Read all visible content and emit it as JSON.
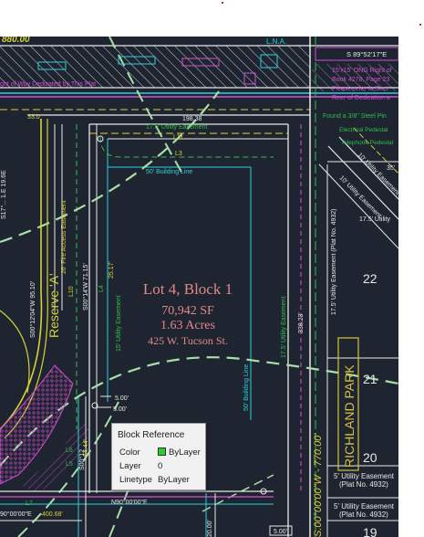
{
  "drawing": {
    "top_left_text": "880.00",
    "lna": "L.N.A.",
    "bearing_top_right": "S 89°52'17\"E",
    "row_note": [
      "15'x15' ONG Right of",
      "Book 4278, Page 23",
      "Please refer to Sect",
      "Reer of Dedication a"
    ],
    "row_dedicated": "ght of Way Dedicated by This Plat",
    "dim_33": "33.0",
    "dim_19858": "198.38",
    "util_ease_top": "17.5' Utility Easement",
    "found_pin": "Found a 3/8\" Steel Pin",
    "elec_pedestal": "Electrical Pedestal",
    "telephone_pedestal": "Telephone Pedestal",
    "l11": "L11",
    "l3": "L3",
    "building_line_top": "50' Building Line",
    "fire_access": "26' Fire Access Easement",
    "bearing_left": "S17°...  1.E 19.6E",
    "dim_35": "35'",
    "richland_util_1": "10' Utility Easement (Plat",
    "richland_util_2": "10' Utility Easement",
    "util_175_small": "17.5' Utility",
    "plat_util_vertical": "17.5' Utility Easement (Plat No. 4932)",
    "reserve_a": "Reserve 'A'",
    "bearing_s00": "S00°12'04\"W  95.10'",
    "bearing_s0014": "S00°14'W  71.15'",
    "l10": "L10",
    "dim_25177": "25.17'",
    "l4": "L4",
    "util_15": "15' Utility Easement",
    "util_175_right": "17.5' Utility Easement",
    "dim_33823": "338.23'",
    "lot_title": "Lot 4, Block 1",
    "lot_sf": "70,942 SF",
    "lot_acres": "1.63 Acres",
    "lot_address": "425 W. Tucson St.",
    "dim_500a": "5.00'",
    "dim_500b": "5.00'",
    "building_line_right": "50' Building Line",
    "lot_22": "22",
    "lot_21": "21",
    "lot_20": "20",
    "lot_19": "19",
    "richland_park": "RICHLAND PARK",
    "bearing_vertical": "S.00°00'00\"W - 770.00'",
    "util_5_a": "5' Utility Easement",
    "util_5_a2": "(Plat No. 4932)",
    "util_5_b": "5' Utility Easement",
    "util_5_b2": "(Plat No. 4932)",
    "dim_6444": "64.44'",
    "s00_lower": "S00°12",
    "l6": "L6",
    "l5": "L5",
    "l7": "L7",
    "bearing_bottom_left": "90°00'00\"E",
    "dim_40068": "400.68'",
    "bearing_bottom_mid": "N90°00'00\"E",
    "dim_2000": "20.00'",
    "dim_500_bottom": "5.00'"
  },
  "tooltip": {
    "title": "Block Reference",
    "rows": [
      {
        "label": "Color",
        "value": "ByLayer",
        "swatch": "#2ecc2e"
      },
      {
        "label": "Layer",
        "value": "0"
      },
      {
        "label": "Linetype",
        "value": "ByLayer"
      }
    ]
  },
  "colors": {
    "background": "#1f2530",
    "white": "#e8e8e8",
    "cyan": "#27d3df",
    "green": "#2fbf4a",
    "yellow": "#d8d233",
    "magenta": "#d64fd6",
    "pale_green": "#a8e0a8",
    "lot_text": "#e08888",
    "richland": "#d6c23a"
  }
}
